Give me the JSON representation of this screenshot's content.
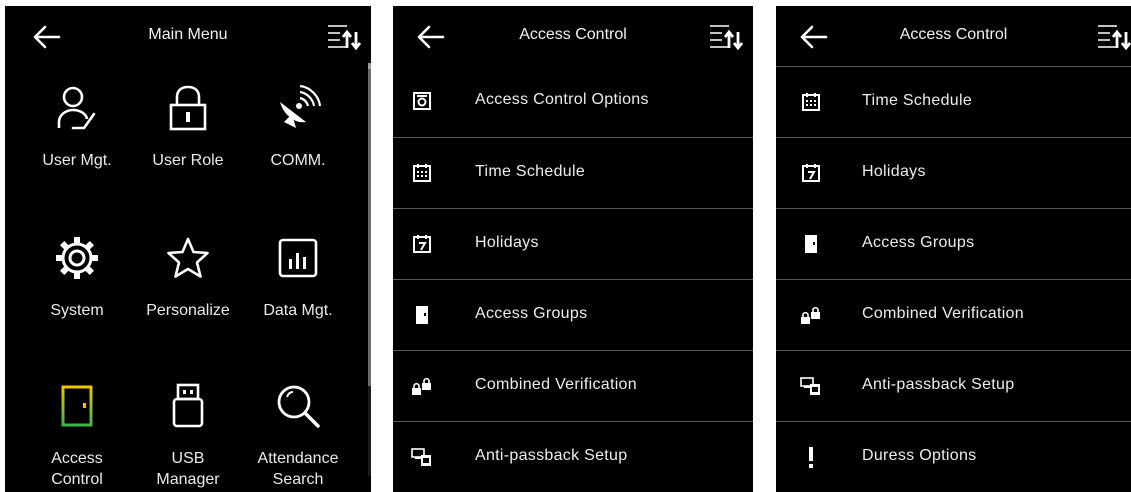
{
  "main_menu": {
    "title": "Main Menu",
    "items": [
      {
        "label": "User Mgt.",
        "icon": "user-icon"
      },
      {
        "label": "User Role",
        "icon": "lock-icon"
      },
      {
        "label": "COMM.",
        "icon": "satellite-dish-icon"
      },
      {
        "label": "System",
        "icon": "gear-icon"
      },
      {
        "label": "Personalize",
        "icon": "star-icon"
      },
      {
        "label": "Data Mgt.",
        "icon": "bar-chart-icon"
      },
      {
        "label": "Access\nControl",
        "icon": "door-icon",
        "highlighted": true
      },
      {
        "label": "USB\nManager",
        "icon": "usb-icon"
      },
      {
        "label": "Attendance\nSearch",
        "icon": "search-icon"
      }
    ]
  },
  "access_control_1": {
    "title": "Access Control",
    "items": [
      {
        "label": "Access Control Options",
        "icon": "options-icon"
      },
      {
        "label": "Time Schedule",
        "icon": "calendar-icon"
      },
      {
        "label": "Holidays",
        "icon": "calendar-7-icon"
      },
      {
        "label": "Access Groups",
        "icon": "door-icon"
      },
      {
        "label": "Combined Verification",
        "icon": "double-lock-icon"
      },
      {
        "label": "Anti-passback Setup",
        "icon": "anti-passback-icon"
      }
    ]
  },
  "access_control_2": {
    "title": "Access Control",
    "items": [
      {
        "label": "Time Schedule",
        "icon": "calendar-icon"
      },
      {
        "label": "Holidays",
        "icon": "calendar-7-icon"
      },
      {
        "label": "Access Groups",
        "icon": "door-icon"
      },
      {
        "label": "Combined Verification",
        "icon": "double-lock-icon"
      },
      {
        "label": "Anti-passback Setup",
        "icon": "anti-passback-icon"
      },
      {
        "label": "Duress Options",
        "icon": "exclamation-icon"
      }
    ]
  },
  "colors": {
    "background": "#000000",
    "text": "#ffffff",
    "highlight_border": "#f2c500",
    "highlight_fill": "#2ea043",
    "divider": "#5a5a5a"
  }
}
